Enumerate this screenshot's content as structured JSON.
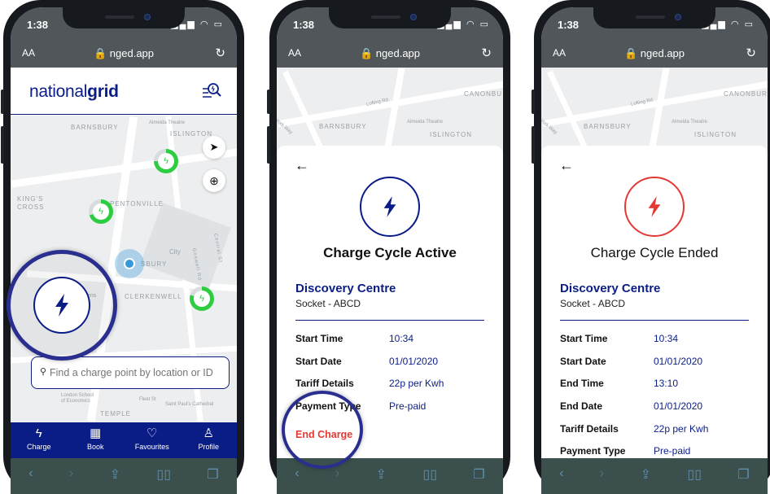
{
  "browser": {
    "time": "1:38",
    "url": "nged.app",
    "text_size": "AA"
  },
  "colors": {
    "brand_blue": "#0a1d87",
    "charging_green": "#2ecc40",
    "ended_red": "#e53935",
    "end_charge_red": "#e53935"
  },
  "screen1": {
    "logo_light": "national",
    "logo_bold": "grid",
    "map_labels": [
      "BARNSBURY",
      "Almeida Theatre",
      "ISLINGTON",
      "KING'S",
      "CROSS",
      "PENTONVILLE",
      "City",
      "SBURY",
      "CLERKENWELL",
      "Goswell Rd",
      "Central St",
      "rkens",
      "London School",
      "of Economics",
      "Fleet St",
      "TEMPLE",
      "Saint Paul's Cathedral"
    ],
    "search_placeholder": "Find a charge point by location or ID",
    "nav": [
      {
        "label": "Charge",
        "icon": "lightning-icon"
      },
      {
        "label": "Book",
        "icon": "calendar-clock-icon"
      },
      {
        "label": "Favourites",
        "icon": "heart-icon"
      },
      {
        "label": "Profile",
        "icon": "person-icon"
      }
    ]
  },
  "screen2": {
    "map_labels": [
      "CANONBU",
      "Lofting Rd",
      "BARNSBURY",
      "Almeida Theatre",
      "ISLINGTON",
      "York Way"
    ],
    "title": "Charge Cycle Active",
    "station": "Discovery Centre",
    "socket": "Socket - ABCD",
    "rows": [
      {
        "key": "Start Time",
        "value": "10:34"
      },
      {
        "key": "Start Date",
        "value": "01/01/2020"
      },
      {
        "key": "Tariff Details",
        "value": "22p per Kwh"
      },
      {
        "key": "Payment Type",
        "value": "Pre-paid"
      }
    ],
    "end_charge": "End Charge"
  },
  "screen3": {
    "map_labels": [
      "CANONBUR",
      "Lofting Rd",
      "BARNSBURY",
      "Almeida Theatre",
      "ISLINGTON",
      "York Way"
    ],
    "title": "Charge Cycle Ended",
    "station": "Discovery Centre",
    "socket": "Socket - ABCD",
    "rows": [
      {
        "key": "Start Time",
        "value": "10:34"
      },
      {
        "key": "Start Date",
        "value": "01/01/2020"
      },
      {
        "key": "End Time",
        "value": "13:10"
      },
      {
        "key": "End Date",
        "value": "01/01/2020"
      },
      {
        "key": "Tariff Details",
        "value": "22p per Kwh"
      },
      {
        "key": "Payment Type",
        "value": "Pre-paid"
      }
    ]
  }
}
